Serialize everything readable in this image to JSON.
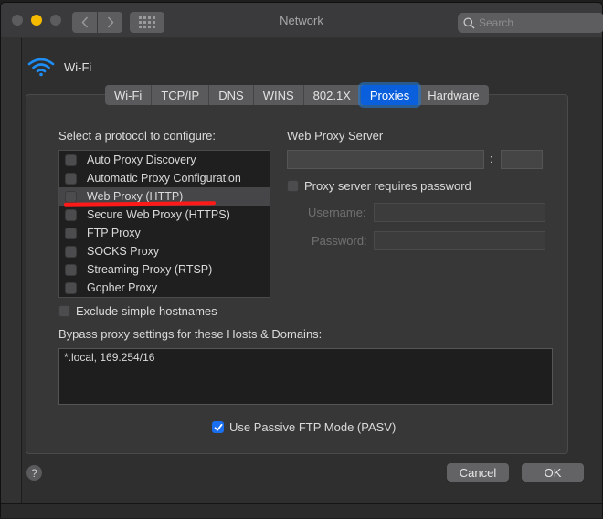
{
  "window": {
    "title": "Network",
    "search": {
      "placeholder": "Search",
      "value": ""
    },
    "nav": {
      "back_icon": "chevron-left-icon",
      "forward_icon": "chevron-right-icon",
      "grid_icon": "grid-icon"
    },
    "traffic_lights": {
      "close": "#5c5c5e",
      "minimize": "#f4bb00",
      "zoom": "#5c5c5e"
    }
  },
  "interface": {
    "icon": "wifi-icon",
    "name": "Wi-Fi",
    "icon_color": "#1e8ef5"
  },
  "tabs": [
    {
      "label": "Wi-Fi",
      "active": false
    },
    {
      "label": "TCP/IP",
      "active": false
    },
    {
      "label": "DNS",
      "active": false
    },
    {
      "label": "WINS",
      "active": false
    },
    {
      "label": "802.1X",
      "active": false
    },
    {
      "label": "Proxies",
      "active": true
    },
    {
      "label": "Hardware",
      "active": false
    }
  ],
  "protocols": {
    "heading": "Select a protocol to configure:",
    "items": [
      {
        "label": "Auto Proxy Discovery",
        "checked": false,
        "selected": false
      },
      {
        "label": "Automatic Proxy Configuration",
        "checked": false,
        "selected": false
      },
      {
        "label": "Web Proxy (HTTP)",
        "checked": false,
        "selected": true
      },
      {
        "label": "Secure Web Proxy (HTTPS)",
        "checked": false,
        "selected": false
      },
      {
        "label": "FTP Proxy",
        "checked": false,
        "selected": false
      },
      {
        "label": "SOCKS Proxy",
        "checked": false,
        "selected": false
      },
      {
        "label": "Streaming Proxy (RTSP)",
        "checked": false,
        "selected": false
      },
      {
        "label": "Gopher Proxy",
        "checked": false,
        "selected": false
      }
    ],
    "annotation_color": "#ff1a1a"
  },
  "proxy_server": {
    "heading": "Web Proxy Server",
    "host_value": "",
    "separator": ":",
    "port_value": "",
    "requires_password_label": "Proxy server requires password",
    "requires_password_checked": false,
    "username_label": "Username:",
    "username_value": "",
    "password_label": "Password:",
    "password_value": ""
  },
  "exclude_simple_hostnames": {
    "label": "Exclude simple hostnames",
    "checked": false
  },
  "bypass": {
    "label": "Bypass proxy settings for these Hosts & Domains:",
    "value": "*.local, 169.254/16"
  },
  "passive_ftp": {
    "label": "Use Passive FTP Mode (PASV)",
    "checked": true
  },
  "footer": {
    "help_label": "?",
    "cancel_label": "Cancel",
    "ok_label": "OK"
  },
  "colors": {
    "accent": "#0a5fdc",
    "checkbox_checked": "#1a6ef0"
  }
}
